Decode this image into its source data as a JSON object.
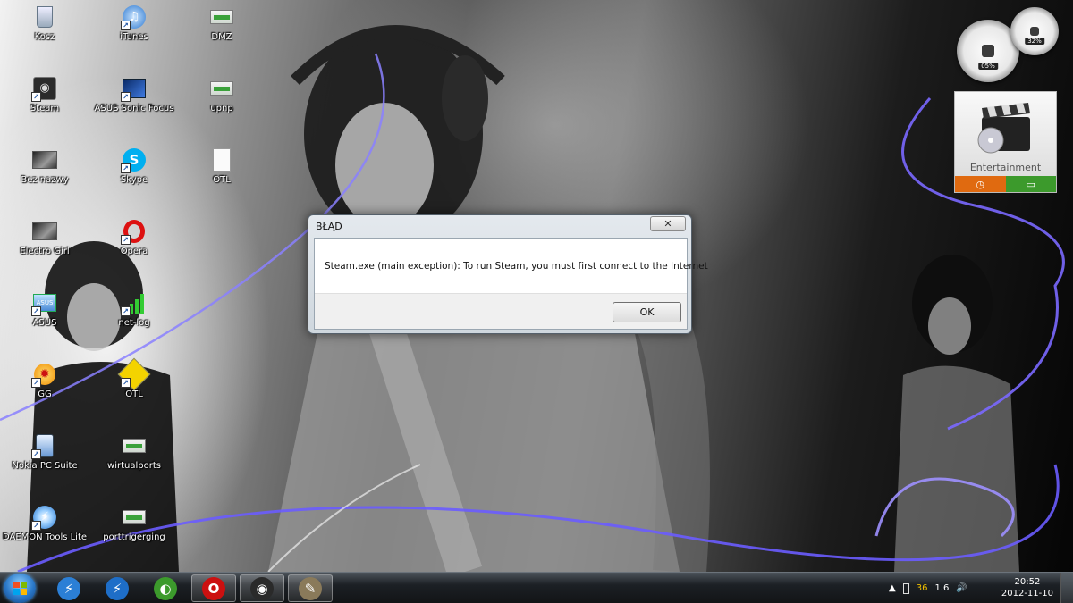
{
  "desktop_icons": [
    {
      "label": "Kosz",
      "icon": "recycle-bin-icon"
    },
    {
      "label": "iTunes",
      "icon": "itunes-icon"
    },
    {
      "label": "DMZ",
      "icon": "network-connection-icon"
    },
    {
      "label": "Steam",
      "icon": "steam-icon"
    },
    {
      "label": "ASUS Sonic Focus",
      "icon": "asus-sonic-focus-icon"
    },
    {
      "label": "upnp",
      "icon": "network-connection-icon"
    },
    {
      "label": "Bez nazwy",
      "icon": "image-file-icon"
    },
    {
      "label": "Skype",
      "icon": "skype-icon"
    },
    {
      "label": "OTL",
      "icon": "text-document-icon"
    },
    {
      "label": "Electro Girl",
      "icon": "image-file-icon"
    },
    {
      "label": "Opera",
      "icon": "opera-icon"
    },
    {
      "label": "ASUS",
      "icon": "asus-icon"
    },
    {
      "label": "net-log",
      "icon": "signal-bars-icon"
    },
    {
      "label": "GG",
      "icon": "gadu-gadu-icon"
    },
    {
      "label": "OTL",
      "icon": "otl-icon"
    },
    {
      "label": "Nokia PC Suite",
      "icon": "nokia-pc-suite-icon"
    },
    {
      "label": "wirtualports",
      "icon": "network-connection-icon"
    },
    {
      "label": "DAEMON Tools Lite",
      "icon": "daemon-tools-icon"
    },
    {
      "label": "porttrigerging",
      "icon": "network-connection-icon"
    }
  ],
  "gadgets": {
    "cpu_meter": {
      "cpu_percent": "05%",
      "memory_percent": "32%",
      "accent": "#d42020"
    },
    "media_center": {
      "title": "Entertainment",
      "left_color": "#e06a10",
      "right_color": "#3c9a2c"
    }
  },
  "dialog": {
    "title": "BŁĄD",
    "close_label": "✕",
    "message": "Steam.exe (main exception): To run Steam, you must first connect to the Internet",
    "ok_label": "OK"
  },
  "taskbar": {
    "pinned": [
      {
        "name": "ie-icon",
        "color": "#2b7fd6"
      },
      {
        "name": "daemon-tools-icon",
        "color": "#1e6ec8"
      },
      {
        "name": "windows-media-icon",
        "color": "#3c9a2c"
      },
      {
        "name": "opera-icon",
        "color": "#cc1010"
      },
      {
        "name": "steam-icon",
        "color": "#2a2a2a"
      },
      {
        "name": "gimp-icon",
        "color": "#8a7a5a"
      }
    ],
    "tray": {
      "show_hidden": "▲",
      "gg_count": "36",
      "speed": "1.6",
      "volume": "🔊"
    },
    "clock": {
      "time": "20:52",
      "date": "2012-11-10"
    }
  }
}
